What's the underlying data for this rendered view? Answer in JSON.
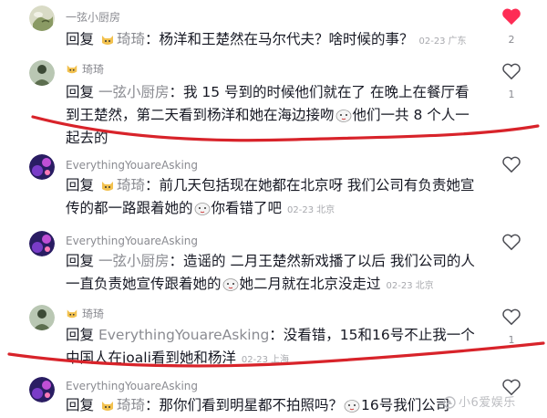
{
  "comments": [
    {
      "username": "一弦小厨房",
      "reply_word": "回复",
      "mention": "琦琦",
      "text": "：杨洋和王楚然在马尔代夫？啥时候的事？",
      "date": "02-23",
      "location": "广东",
      "likes": "2",
      "liked": true
    },
    {
      "username": "琦琦",
      "reply_word": "回复",
      "mention": "一弦小厨房",
      "text_a": "：我 15 号到的时候他们就在了 在晚上在餐厅看到王楚然，第二天看到杨洋和她在海边接吻",
      "text_b": "他们一共 8 个人一起去的",
      "likes": "1",
      "liked": false
    },
    {
      "username": "EverythingYouareAsking",
      "reply_word": "回复",
      "mention": "琦琦",
      "text_a": "：前几天包括现在她都在北京呀 我们公司有负责她宣传的都一路跟着她的",
      "text_b": "你看错了吧",
      "date": "02-23",
      "location": "北京",
      "likes": "",
      "liked": false
    },
    {
      "username": "EverythingYouareAsking",
      "reply_word": "回复",
      "mention": "一弦小厨房",
      "text_a": "：造谣的 二月王楚然新戏播了以后 我们公司的人一直负责她宣传跟着她的",
      "text_b": "她二月就在北京没走过",
      "date": "02-23",
      "location": "北京",
      "likes": "",
      "liked": false
    },
    {
      "username": "琦琦",
      "reply_word": "回复",
      "mention": "EverythingYouareAsking",
      "text": "：没看错，15和16号不止我一个中国人在joali看到她和杨洋",
      "date": "02-23",
      "location": "上海",
      "likes": "1",
      "liked": false
    },
    {
      "username": "EverythingYouareAsking",
      "reply_word": "回复",
      "mention": "琦琦",
      "text_a": "：那你们看到明星都不拍照吗？",
      "text_b": "16号我们公司的人还",
      "likes": "",
      "liked": false
    }
  ],
  "watermark": {
    "text": "小6爱娱乐"
  },
  "colors": {
    "annotation_red": "#d8232a",
    "like_active": "#fe2c55",
    "secondary_text": "#8a8b91"
  }
}
